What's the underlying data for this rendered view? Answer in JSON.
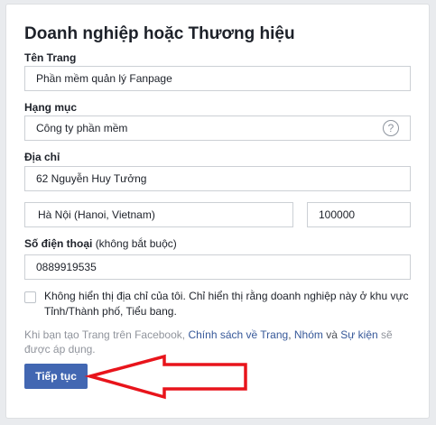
{
  "form": {
    "title": "Doanh nghiệp hoặc Thương hiệu",
    "page_name": {
      "label": "Tên Trang",
      "value": "Phần mềm quản lý Fanpage"
    },
    "category": {
      "label": "Hạng mục",
      "value": "Công ty phần mềm",
      "help_icon": "question-mark",
      "help_glyph": "?"
    },
    "address": {
      "label": "Địa chỉ",
      "street": "62 Nguyễn Huy Tưởng",
      "city": "Hà Nội (Hanoi, Vietnam)",
      "zip": "100000"
    },
    "phone": {
      "label": "Số điện thoại",
      "optional": "(không bắt buộc)",
      "value": "0889919535"
    },
    "hide_address": {
      "checked": false,
      "text": "Không hiển thị địa chỉ của tôi. Chỉ hiển thị rằng doanh nghiệp này ở khu vực Tỉnh/Thành phố, Tiểu bang."
    },
    "note": {
      "prefix": "Khi bạn tạo Trang trên Facebook,",
      "link_policy": "Chính sách về Trang",
      "sep1": ",",
      "link_groups": "Nhóm",
      "and": "và",
      "link_events": "Sự kiện",
      "suffix": "sẽ được áp dụng."
    },
    "continue_button": "Tiếp tục"
  },
  "annotation": {
    "arrow_color": "#e8141b"
  },
  "colors": {
    "primary": "#4267b2",
    "link": "#365899"
  }
}
